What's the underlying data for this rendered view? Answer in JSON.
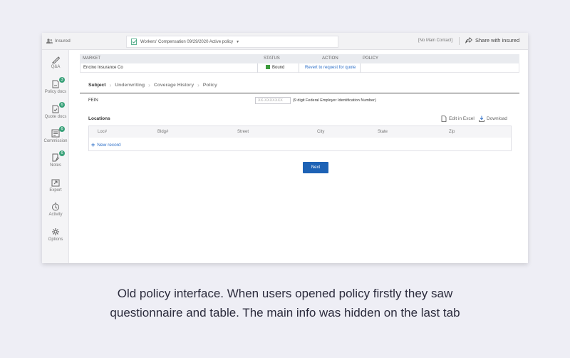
{
  "topbar": {
    "insured_label": "Insured",
    "policy_selector": "Workers' Compensation  09/29/2020  Active policy",
    "no_contact": "[No Main Contact]",
    "share_label": "Share with insured"
  },
  "sidebar": {
    "items": [
      {
        "label": "Q&A",
        "icon": "qa-icon",
        "badge": ""
      },
      {
        "label": "Policy docs",
        "icon": "policy-docs-icon",
        "badge": "3"
      },
      {
        "label": "Quote docs",
        "icon": "quote-docs-icon",
        "badge": "6"
      },
      {
        "label": "Commission",
        "icon": "commission-icon",
        "badge": "6"
      },
      {
        "label": "Notes",
        "icon": "notes-icon",
        "badge": "6"
      },
      {
        "label": "Export",
        "icon": "export-icon",
        "badge": ""
      },
      {
        "label": "Activity",
        "icon": "activity-icon",
        "badge": ""
      },
      {
        "label": "Options",
        "icon": "options-icon",
        "badge": ""
      }
    ]
  },
  "market_table": {
    "headers": {
      "market": "MARKET",
      "status": "STATUS",
      "action": "ACTION",
      "policy": "POLICY"
    },
    "row": {
      "market": "Encino Insurance Co",
      "status": "Bound",
      "action": "Revert to request for quote",
      "policy": ""
    },
    "status_color": "#3d9b3d"
  },
  "tabs": [
    "Subject",
    "Underwriting",
    "Coverage History",
    "Policy"
  ],
  "fein": {
    "label": "FEIN",
    "placeholder": "XX-XXXXXXX",
    "help": "(9 digit Federal Employer Identification Number)"
  },
  "locations": {
    "title": "Locations",
    "edit_excel": "Edit in Excel",
    "download": "Download",
    "columns": [
      "Loc#",
      "Bldg#",
      "Street",
      "City",
      "State",
      "Zip"
    ],
    "new_record": "New record"
  },
  "next_button": "Next",
  "caption": {
    "line1": "Old policy interface. When users opened policy firstly they saw",
    "line2": "questionnaire and table. The main info was hidden on the last tab"
  },
  "colors": {
    "accent": "#1d62b5",
    "link": "#2a6dc7",
    "badge": "#3aa27a",
    "background": "#eeeef5"
  }
}
